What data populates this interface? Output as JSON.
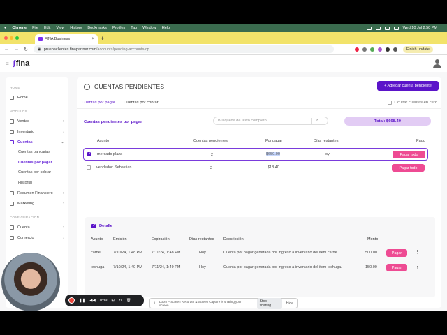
{
  "menubar": {
    "apple": "",
    "app": "Chrome",
    "items": [
      "File",
      "Edit",
      "View",
      "History",
      "Bookmarks",
      "Profiles",
      "Tab",
      "Window",
      "Help"
    ],
    "clock": "Wed 10 Jul  2:50 PM"
  },
  "browser": {
    "tab_title": "FINA Business",
    "url_host": "pruebaclientes.finapartner.com",
    "url_path": "/accounts/pending-accounts/cp",
    "finish_update": "Finish update"
  },
  "app": {
    "logo": "fina"
  },
  "sidebar": {
    "sections": {
      "home": "HOME",
      "modules": "MÓDULOS",
      "config": "CONFIGURACIÓN"
    },
    "home_item": "Home",
    "items": [
      "Ventas",
      "Inventario",
      "Cuentas"
    ],
    "sub_items": [
      "Cuentas bancarias",
      "Cuentas por pagar",
      "Cuentas por cobrar",
      "Historial"
    ],
    "more_items": [
      "Resumen Financiero",
      "Marketing"
    ],
    "config_items": [
      "Cuenta",
      "Comercio"
    ]
  },
  "main": {
    "title": "CUENTAS PENDIENTES",
    "add_button": "+ Agregar cuenta pendiente",
    "tabs": [
      "Cuentas por pagar",
      "Cuentas por cobrar"
    ],
    "hide_zero": "Ocultar cuentas en cero",
    "pending_header": "Cuentas pendientes por pagar",
    "search_placeholder": "Búsqueda de texto completo...",
    "total": "Total: $668.40",
    "columns": [
      "Asunto",
      "Cuentas pendientes",
      "Por pagar",
      "Días restantes",
      "Pago"
    ],
    "rows": [
      {
        "asunto": "mercado plaza",
        "pendientes": "2",
        "por_pagar": "$650.00",
        "dias": "Hoy",
        "button": "Pagar todo"
      },
      {
        "asunto": "vendedor: Sebastian",
        "pendientes": "2",
        "por_pagar": "$18.40",
        "dias": "",
        "button": "Pagar todo"
      }
    ]
  },
  "detail": {
    "title": "Detalle",
    "columns": [
      "Asunto",
      "Emisión",
      "Expiración",
      "Días restantes",
      "Descripción",
      "Monto"
    ],
    "rows": [
      {
        "asunto": "carne",
        "emision": "7/10/24, 1:48 PM",
        "expiracion": "7/11/24, 1:48 PM",
        "dias": "Hoy",
        "descripcion": "Cuenta por pagar generada por ingreso a inventario del item carne.",
        "monto": "500.00",
        "button": "Pagar"
      },
      {
        "asunto": "lechuga",
        "emision": "7/10/24, 1:49 PM",
        "expiracion": "7/11/24, 1:49 PM",
        "dias": "Hoy",
        "descripcion": "Cuenta por pagar generada por ingreso a inventario del item lechuga.",
        "monto": "150.00",
        "button": "Pagar"
      }
    ]
  },
  "recorder": {
    "time": "0:39"
  },
  "sharing": {
    "text": "Loom – Screen Recorder & Screen Capture is sharing your screen.",
    "stop": "Stop sharing",
    "hide": "Hide"
  }
}
